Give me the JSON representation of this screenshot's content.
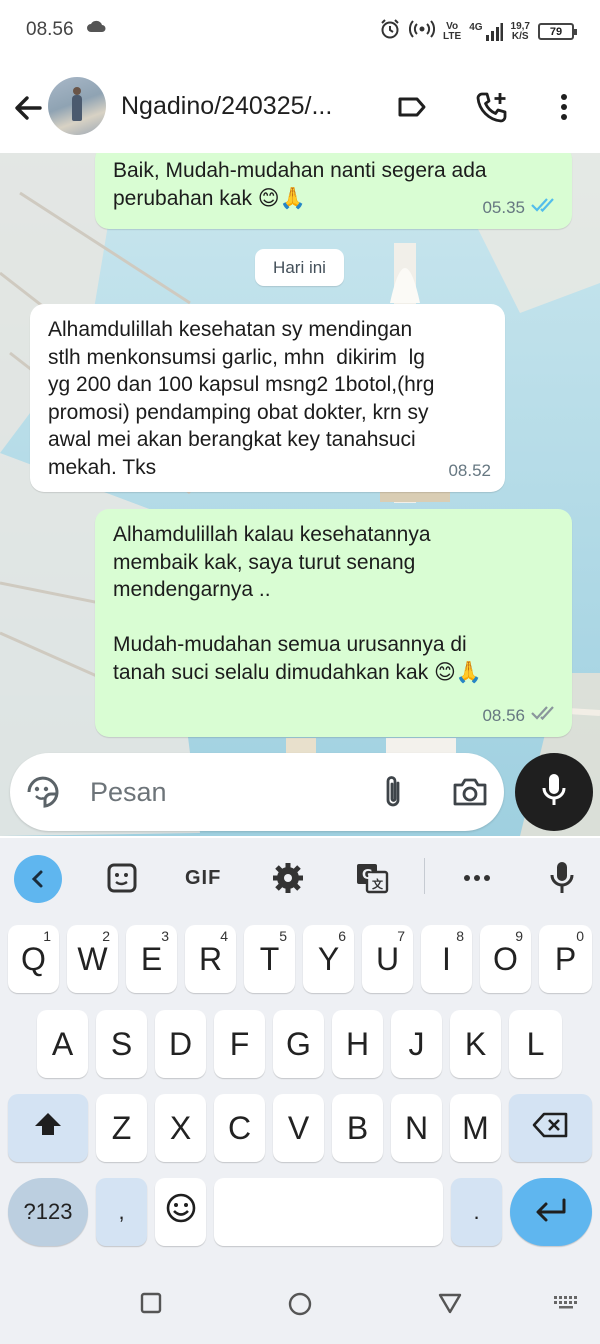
{
  "status_bar": {
    "time": "08.56",
    "network_vo": "Vo",
    "network_lte": "LTE",
    "network_type": "4G",
    "speed_value": "19,7",
    "speed_unit": "K/S",
    "battery": "79"
  },
  "header": {
    "contact_name": "Ngadino/240325/..."
  },
  "messages": [
    {
      "direction": "out",
      "text": "Baik, Mudah-mudahan nanti segera ada\nperubahan kak ",
      "emojis": "😊🙏",
      "time": "05.35",
      "status": "read"
    },
    {
      "direction": "in",
      "text": "Alhamdulillah kesehatan sy mendingan\nstlh menkonsumsi garlic, mhn  dikirim  lg\nyg 200 dan 100 kapsul msng2 1botol,(hrg\npromosi) pendamping obat dokter, krn sy\nawal mei akan berangkat key tanahsuci\nmekah. Tks",
      "time": "08.52"
    },
    {
      "direction": "out",
      "text": "Alhamdulillah kalau kesehatannya\nmembaik kak, saya turut senang\nmendengarnya ..\n\nMudah-mudahan semua urusannya di\ntanah suci selalu dimudahkan kak ",
      "emojis": "😊🙏",
      "time": "08.56",
      "status": "delivered"
    }
  ],
  "date_divider": "Hari ini",
  "composer": {
    "placeholder": "Pesan"
  },
  "keyboard": {
    "gif_label": "GIF",
    "row1": [
      {
        "key": "Q",
        "hint": "1"
      },
      {
        "key": "W",
        "hint": "2"
      },
      {
        "key": "E",
        "hint": "3"
      },
      {
        "key": "R",
        "hint": "4"
      },
      {
        "key": "T",
        "hint": "5"
      },
      {
        "key": "Y",
        "hint": "6"
      },
      {
        "key": "U",
        "hint": "7"
      },
      {
        "key": "I",
        "hint": "8"
      },
      {
        "key": "O",
        "hint": "9"
      },
      {
        "key": "P",
        "hint": "0"
      }
    ],
    "row2": [
      "A",
      "S",
      "D",
      "F",
      "G",
      "H",
      "J",
      "K",
      "L"
    ],
    "row3": [
      "Z",
      "X",
      "C",
      "V",
      "B",
      "N",
      "M"
    ],
    "num_label": "?123",
    "comma": ",",
    "period": "."
  },
  "colors": {
    "outgoing_bubble": "#d9fdd3",
    "incoming_bubble": "#ffffff",
    "read_tick": "#53bdeb",
    "accent_blue": "#5fb6ef"
  },
  "icons": [
    "back-arrow-icon",
    "label-icon",
    "add-call-icon",
    "more-vert-icon",
    "sticker-icon",
    "attach-icon",
    "camera-icon",
    "mic-icon",
    "chevron-left-icon",
    "settings-icon",
    "translate-icon",
    "more-horiz-icon",
    "shift-icon",
    "backspace-icon",
    "emoji-icon",
    "enter-icon"
  ]
}
